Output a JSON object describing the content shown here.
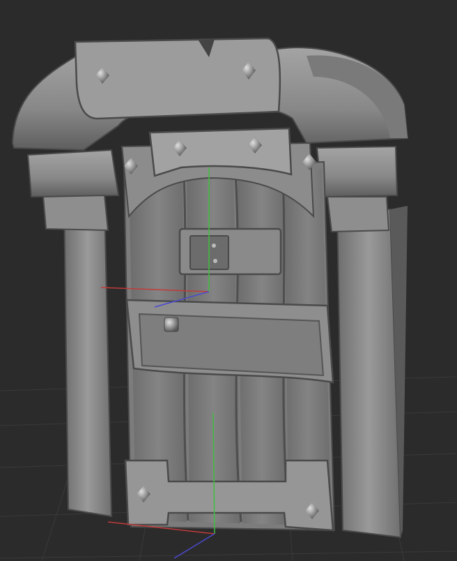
{
  "viewport": {
    "content": "3d-sculpt-wooden-door-model",
    "background_color": "#2b2b2b",
    "grid_color": "#3a3a3a",
    "material_color": "#8a8a8a",
    "axis_colors": {
      "x": "#c23a3a",
      "y": "#3fbf3f",
      "z": "#4a4ad0"
    }
  }
}
